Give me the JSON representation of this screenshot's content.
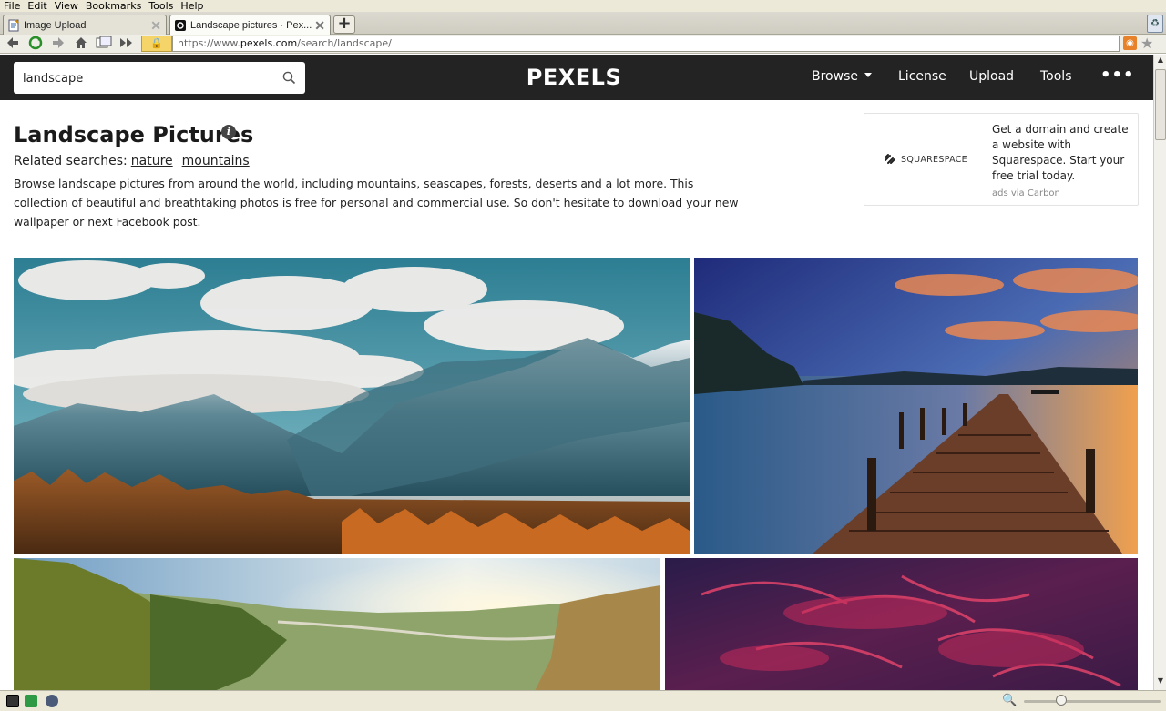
{
  "menubar": {
    "items": [
      "File",
      "Edit",
      "View",
      "Bookmarks",
      "Tools",
      "Help"
    ]
  },
  "tabs": [
    {
      "title": "Image Upload",
      "active": false
    },
    {
      "title": "Landscape pictures · Pex...",
      "active": true
    }
  ],
  "navigation": {
    "url_prefix": "https://www.",
    "url_domain": "pexels.com",
    "url_path": "/search/landscape/"
  },
  "header": {
    "search_value": "landscape",
    "logo": "PEXELS",
    "nav": {
      "browse": "Browse",
      "license": "License",
      "upload": "Upload",
      "tools": "Tools",
      "more": "•••"
    }
  },
  "main": {
    "title": "Landscape Pictures",
    "info": "i",
    "related_label": "Related searches:",
    "related": [
      "nature",
      "mountains"
    ],
    "description": "Browse landscape pictures from around the world, including mountains, seascapes, forests, deserts and a lot more. This collection of beautiful and breathtaking photos is free for personal and commercial use. So don't hesitate to download your new wallpaper or next Facebook post."
  },
  "ad": {
    "brand": "SQUARESPACE",
    "text": "Get a domain and create a website with Squarespace. Start your free trial today.",
    "via": "ads via Carbon"
  },
  "photos": [
    {
      "icon": "mountain-lake-photo"
    },
    {
      "icon": "wooden-pier-sunset-photo"
    },
    {
      "icon": "valley-sunrise-photo"
    },
    {
      "icon": "red-sky-clouds-photo"
    }
  ],
  "colors": {
    "topnav_bg": "#232323",
    "accent": "#05a081"
  }
}
